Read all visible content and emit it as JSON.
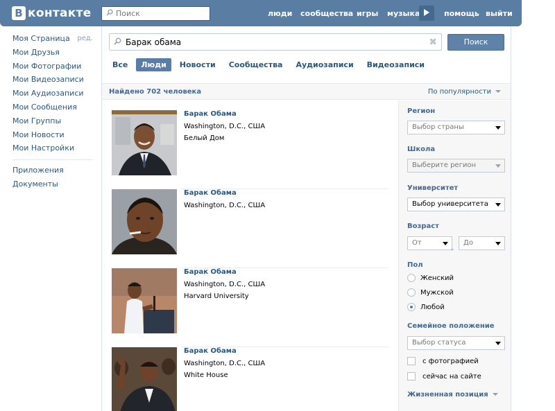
{
  "colors": {
    "header_bg": "#597da3",
    "link": "#2b587a",
    "button": "#5e82a8",
    "panel_bg": "#f7f7f7"
  },
  "header": {
    "logo_letter": "B",
    "logo_text": "контакте",
    "search_placeholder": "Поиск",
    "nav": [
      {
        "label": "люди"
      },
      {
        "label": "сообщества"
      },
      {
        "label": "игры"
      },
      {
        "label": "музыка"
      },
      {
        "label": "помощь"
      },
      {
        "label": "выйти"
      }
    ]
  },
  "sidebar": {
    "edit_label": "ред.",
    "items": [
      {
        "label": "Моя Страница"
      },
      {
        "label": "Мои Друзья"
      },
      {
        "label": "Мои Фотографии"
      },
      {
        "label": "Мои Видеозаписи"
      },
      {
        "label": "Мои Аудиозаписи"
      },
      {
        "label": "Мои Сообщения"
      },
      {
        "label": "Мои Группы"
      },
      {
        "label": "Мои Новости"
      },
      {
        "label": "Мои Настройки"
      }
    ],
    "extra": [
      {
        "label": "Приложения"
      },
      {
        "label": "Документы"
      }
    ]
  },
  "search": {
    "query": "Барак обама",
    "button_label": "Поиск",
    "clear_glyph": "✖",
    "tabs": [
      {
        "label": "Все",
        "active": false
      },
      {
        "label": "Люди",
        "active": true
      },
      {
        "label": "Новости",
        "active": false
      },
      {
        "label": "Сообщества",
        "active": false
      },
      {
        "label": "Аудиозаписи",
        "active": false
      },
      {
        "label": "Видеозаписи",
        "active": false
      }
    ],
    "found_text": "Найдено 702 человека",
    "sort_label": "По популярности"
  },
  "results": [
    {
      "name": "Барак Обама",
      "city": "Washington, D.C., США",
      "work": "Белый Дом"
    },
    {
      "name": "Барак Обама",
      "city": "Washington, D.C., США",
      "work": ""
    },
    {
      "name": "Барак Обама",
      "city": "Washington, D.C., США",
      "work": "Harvard University"
    },
    {
      "name": "Барак Обама",
      "city": "Washington, D.C., США",
      "work": "White House"
    }
  ],
  "filters": {
    "region_label": "Регион",
    "region_value": "Выбор страны",
    "school_label": "Школа",
    "school_value": "Выберите регион",
    "university_label": "Университет",
    "university_value": "Выбор университета",
    "age_label": "Возраст",
    "age_from": "От",
    "age_dash": "-",
    "age_to": "До",
    "gender_label": "Пол",
    "gender_options": [
      {
        "label": "Женский",
        "selected": false
      },
      {
        "label": "Мужской",
        "selected": false
      },
      {
        "label": "Любой",
        "selected": true
      }
    ],
    "family_label": "Семейное положение",
    "family_value": "Выбор статуса",
    "with_photo_label": "с фотографией",
    "online_label": "сейчас на сайте",
    "life_position_label": "Жизненная позиция"
  }
}
